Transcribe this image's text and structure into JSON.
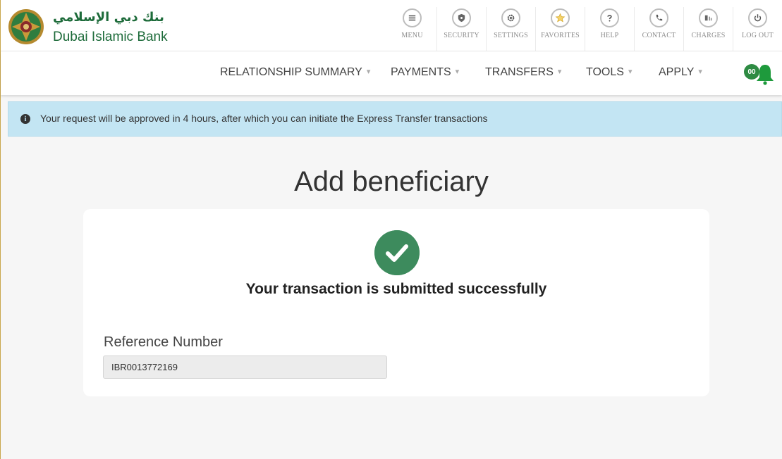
{
  "brand": {
    "name_ar": "بنك دبي الإسلامي",
    "name_en": "Dubai Islamic Bank"
  },
  "toolbar": [
    {
      "label": "MENU",
      "icon": "menu-icon"
    },
    {
      "label": "SECURITY",
      "icon": "shield-icon"
    },
    {
      "label": "SETTINGS",
      "icon": "gear-icon"
    },
    {
      "label": "FAVORITES",
      "icon": "star-icon"
    },
    {
      "label": "HELP",
      "icon": "help-icon"
    },
    {
      "label": "CONTACT",
      "icon": "phone-icon"
    },
    {
      "label": "CHARGES",
      "icon": "charges-icon"
    },
    {
      "label": "LOG OUT",
      "icon": "power-icon"
    }
  ],
  "nav": [
    {
      "label": "RELATIONSHIP SUMMARY"
    },
    {
      "label": "PAYMENTS"
    },
    {
      "label": "TRANSFERS"
    },
    {
      "label": "TOOLS"
    },
    {
      "label": "APPLY"
    }
  ],
  "notifications": {
    "count": "00",
    "icon": "bell-icon"
  },
  "alert": {
    "icon": "info-icon",
    "text": "Your request will be approved in 4 hours, after which you can initiate the Express Transfer transactions"
  },
  "page": {
    "title": "Add beneficiary",
    "success_message": "Your transaction is submitted successfully",
    "reference_label": "Reference Number",
    "reference_value": "IBR0013772169"
  },
  "colors": {
    "brand_green": "#1d6b3a",
    "success_green": "#3d8b5d",
    "alert_bg": "#c3e5f3",
    "badge_green": "#2e8b43"
  }
}
